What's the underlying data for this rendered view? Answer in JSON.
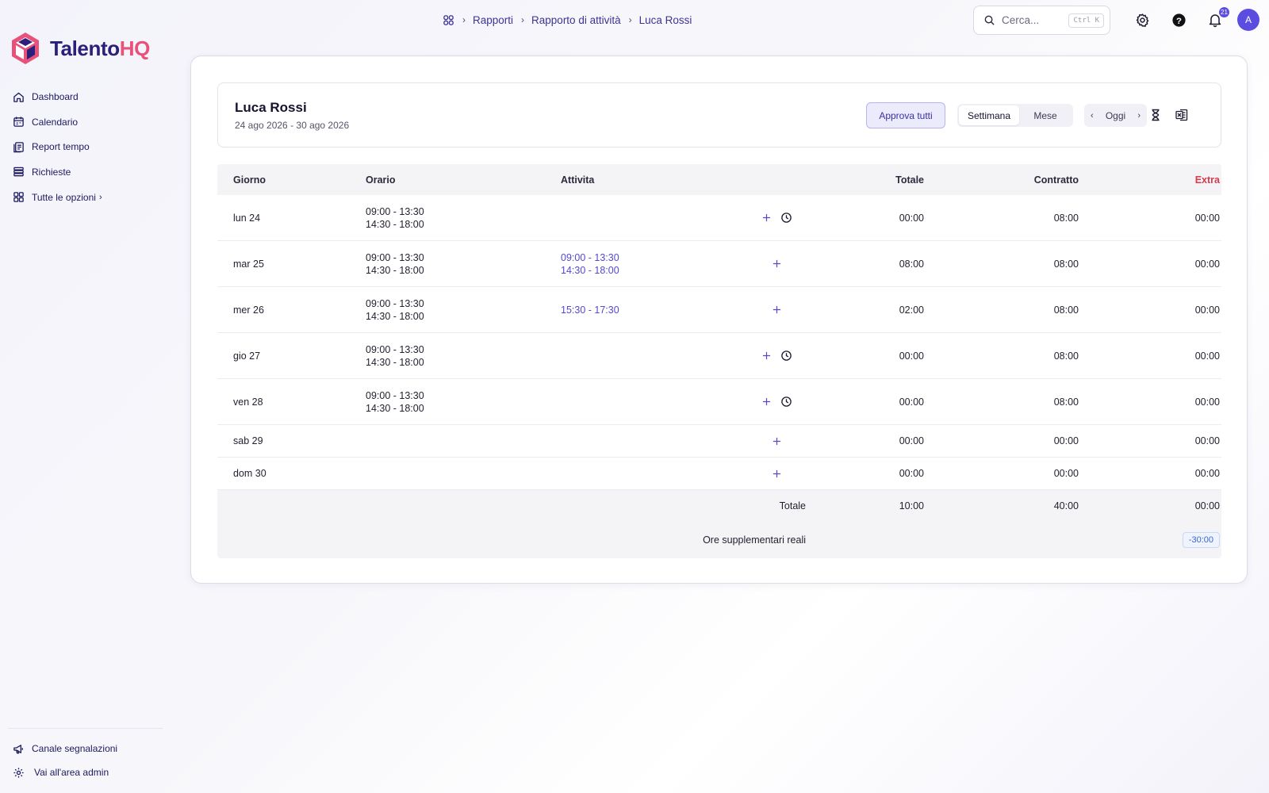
{
  "app": {
    "logo_part1": "Talento",
    "logo_part2": "HQ",
    "brand_primary": "#2a1f7a",
    "brand_accent": "#e8527a"
  },
  "sidebar": {
    "items": [
      {
        "label": "Dashboard",
        "icon": "home-icon"
      },
      {
        "label": "Calendario",
        "icon": "calendar-icon"
      },
      {
        "label": "Report tempo",
        "icon": "report-icon"
      },
      {
        "label": "Richieste",
        "icon": "list-icon"
      }
    ],
    "more_label": "Tutte le opzioni",
    "bottom": [
      {
        "label": "Canale segnalazioni",
        "icon": "megaphone-icon"
      },
      {
        "label": "Vai all'area admin",
        "icon": "gear-icon"
      }
    ]
  },
  "breadcrumb": [
    "Rapporti",
    "Rapporto di attività",
    "Luca Rossi"
  ],
  "search": {
    "placeholder": "Cerca...",
    "shortcut": "Ctrl K"
  },
  "notifications": {
    "count": "21"
  },
  "user": {
    "avatar_initial": "A"
  },
  "header": {
    "name": "Luca Rossi",
    "range": "24 ago 2026 - 30 ago 2026",
    "approve_label": "Approva tutti",
    "view_week": "Settimana",
    "view_month": "Mese",
    "today_label": "Oggi"
  },
  "table": {
    "columns": {
      "day": "Giorno",
      "schedule": "Orario",
      "activity": "Attivita",
      "total": "Totale",
      "contract": "Contratto",
      "extra": "Extra"
    },
    "rows": [
      {
        "day": "lun 24",
        "schedule": [
          "09:00 - 13:30",
          "14:30 - 18:00"
        ],
        "activity": [
          "",
          ""
        ],
        "total": "00:00",
        "contract": "08:00",
        "extra": "00:00"
      },
      {
        "day": "mar 25",
        "schedule": [
          "09:00 - 13:30",
          "14:30 - 18:00"
        ],
        "activity": [
          "09:00 - 13:30",
          "14:30 - 18:00"
        ],
        "total": "08:00",
        "contract": "08:00",
        "extra": "00:00"
      },
      {
        "day": "mer 26",
        "schedule": [
          "09:00 - 13:30",
          "14:30 - 18:00"
        ],
        "activity": [
          "15:30 - 17:30",
          ""
        ],
        "total": "02:00",
        "contract": "08:00",
        "extra": "00:00"
      },
      {
        "day": "gio 27",
        "schedule": [
          "09:00 - 13:30",
          "14:30 - 18:00"
        ],
        "activity": [
          "",
          ""
        ],
        "total": "00:00",
        "contract": "08:00",
        "extra": "00:00"
      },
      {
        "day": "ven 28",
        "schedule": [
          "09:00 - 13:30",
          "14:30 - 18:00"
        ],
        "activity": [
          "",
          ""
        ],
        "total": "00:00",
        "contract": "08:00",
        "extra": "00:00"
      },
      {
        "day": "sab 29",
        "total": "00:00",
        "contract": "00:00",
        "extra": "00:00"
      },
      {
        "day": "dom 30",
        "total": "00:00",
        "contract": "00:00",
        "extra": "00:00"
      }
    ],
    "footer": {
      "total_label": "Totale",
      "total": "10:00",
      "contract": "40:00",
      "extra": "00:00",
      "overtime_label": "Ore supplementari reali",
      "overtime_value": "-30:00"
    }
  },
  "colors": {
    "accent": "#5b4de0",
    "extra_header": "#d93a4c",
    "activity_text": "#5547d0"
  }
}
